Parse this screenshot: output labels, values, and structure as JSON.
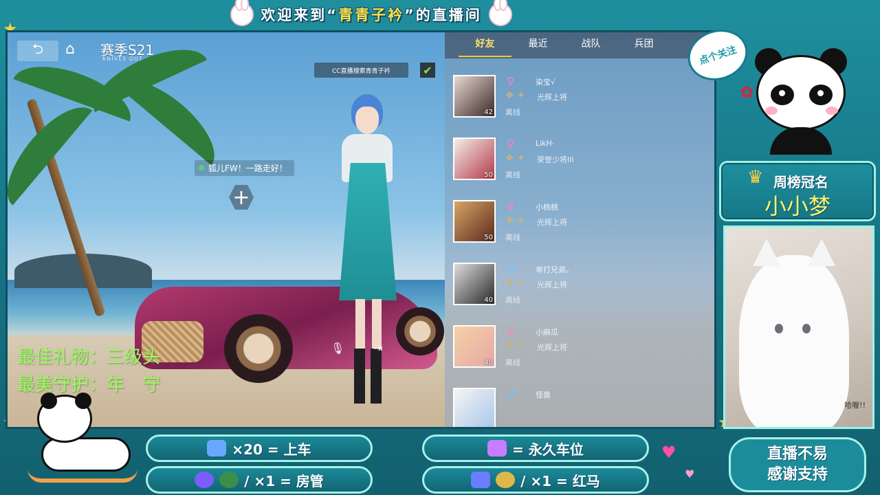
{
  "banner": {
    "prefix": "欢迎来到“",
    "highlight": "青青子衿",
    "suffix": "”的直播间"
  },
  "hud": {
    "back_icon": "back-arrow-icon",
    "home_icon": "home-icon",
    "season": "赛季S21",
    "season_sub": "KNIVES OUT",
    "cc_notice": "CC直播搜索青青子衿",
    "check_icon": "check-icon",
    "message": "狐儿FW！一路走好！",
    "plus": "+",
    "mic_icon": "mic-icon",
    "exit_icon": "exit-icon"
  },
  "gift": {
    "best_gift": "最佳礼物：三级头",
    "best_guard": "最美守护：年　守"
  },
  "friends": {
    "tabs": [
      {
        "label": "好友",
        "active": true
      },
      {
        "label": "最近",
        "active": false
      },
      {
        "label": "战队",
        "active": false
      },
      {
        "label": "兵团",
        "active": false
      }
    ],
    "rows": [
      {
        "name": "染宝√",
        "gender": "♀",
        "gender_color": "#ff7fc4",
        "rank": "光辉上将",
        "status": "离线",
        "level": "42"
      },
      {
        "name": "LikH·",
        "gender": "♀",
        "gender_color": "#ff7fc4",
        "rank": "荣誉少将III",
        "status": "离线",
        "level": "50"
      },
      {
        "name": "小桃桃",
        "gender": "♀",
        "gender_color": "#ff7fc4",
        "rank": "光辉上将",
        "status": "离线",
        "level": "50"
      },
      {
        "name": "单打兄弟。",
        "gender": "♂",
        "gender_color": "#6ec8ff",
        "rank": "光辉上将",
        "status": "离线",
        "level": "40"
      },
      {
        "name": "小麻瓜",
        "gender": "♀",
        "gender_color": "#ff7fc4",
        "rank": "光辉上将",
        "status": "离线",
        "level": "48"
      },
      {
        "name": "怪兽",
        "gender": "♂",
        "gender_color": "#6ec8ff",
        "rank": "",
        "status": "",
        "level": ""
      }
    ]
  },
  "follow": {
    "label": "点个关注"
  },
  "weekly": {
    "title": "周榜冠名",
    "name": "小小梦"
  },
  "cam": {
    "tag": "哈喔!!"
  },
  "rewards": [
    {
      "text": "×20 = 上车",
      "icon_color": "#6aa8ff"
    },
    {
      "text": "= 永久车位",
      "icon_color": "#c77dff"
    },
    {
      "text": "/ ×1 = 房管",
      "icon_color": "#7b5cff"
    },
    {
      "text": "/ ×1 = 红马",
      "icon_color": "#6a7cff"
    }
  ],
  "thanks": {
    "line1": "直播不易",
    "line2": "感谢支持"
  }
}
